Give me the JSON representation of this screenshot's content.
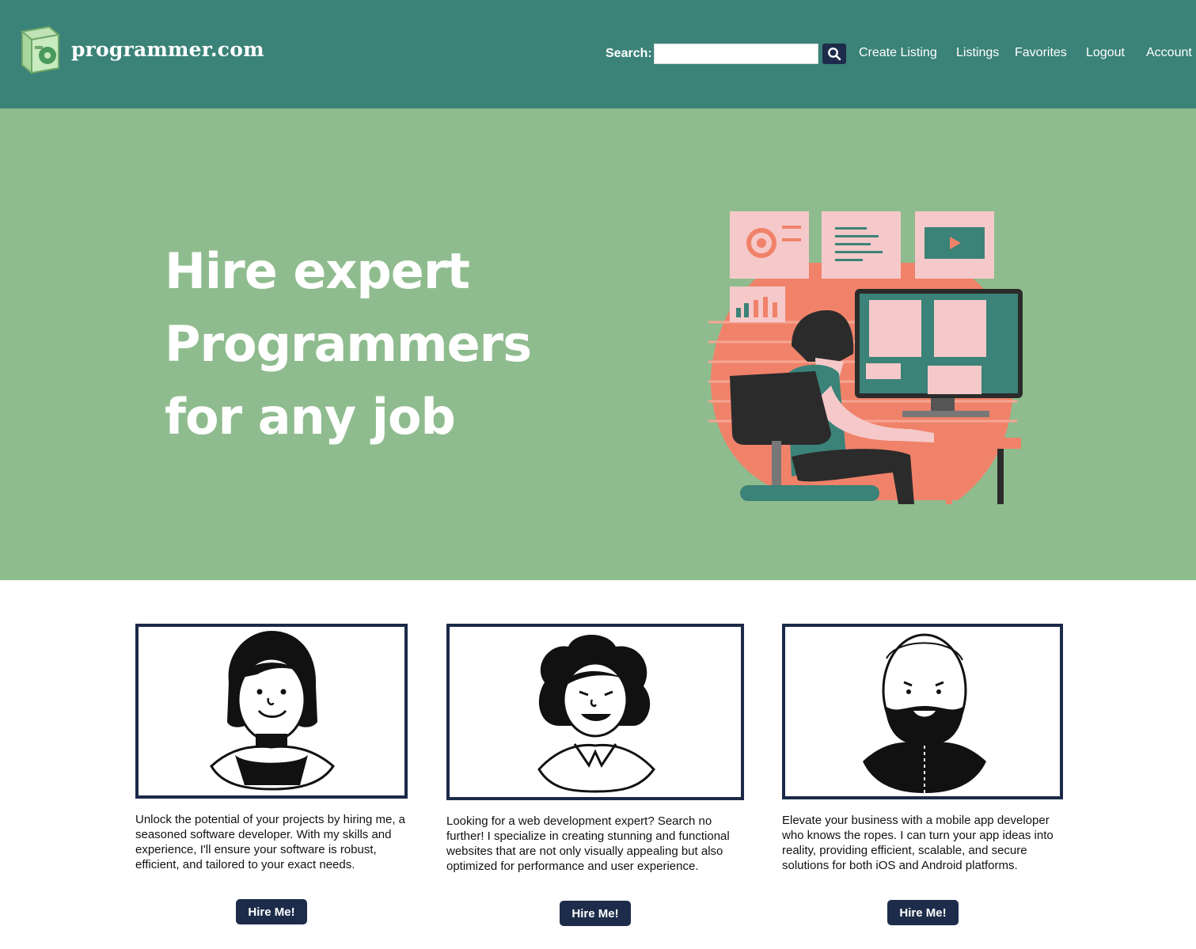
{
  "header": {
    "brand": "programmer.com",
    "search_label": "Search:",
    "search_value": "",
    "nav": [
      "Create Listing",
      "Listings",
      "Favorites",
      "Logout",
      "Account"
    ]
  },
  "hero": {
    "title_lines": [
      "Hire expert",
      "Programmers",
      "for any job"
    ]
  },
  "cards": [
    {
      "text": "Unlock the potential of your projects by hiring me, a seasoned software developer. With my skills and experience, I'll ensure your software is robust, efficient, and tailored to your exact needs.",
      "button": "Hire Me!"
    },
    {
      "text": "Looking for a web development expert? Search no further! I specialize in creating stunning and functional websites that are not only visually appealing but also optimized for performance and user experience.",
      "button": "Hire Me!"
    },
    {
      "text": "Elevate your business with a mobile app developer who knows the ropes. I can turn your app ideas into reality, providing efficient, scalable, and secure solutions for both iOS and Android platforms.",
      "button": "Hire Me!"
    }
  ],
  "colors": {
    "header_bg": "#3b8278",
    "hero_bg": "#8fbc8e",
    "button_bg": "#1c2c4a",
    "card_border": "#1b2a48",
    "accent_salmon": "#f0826a"
  }
}
